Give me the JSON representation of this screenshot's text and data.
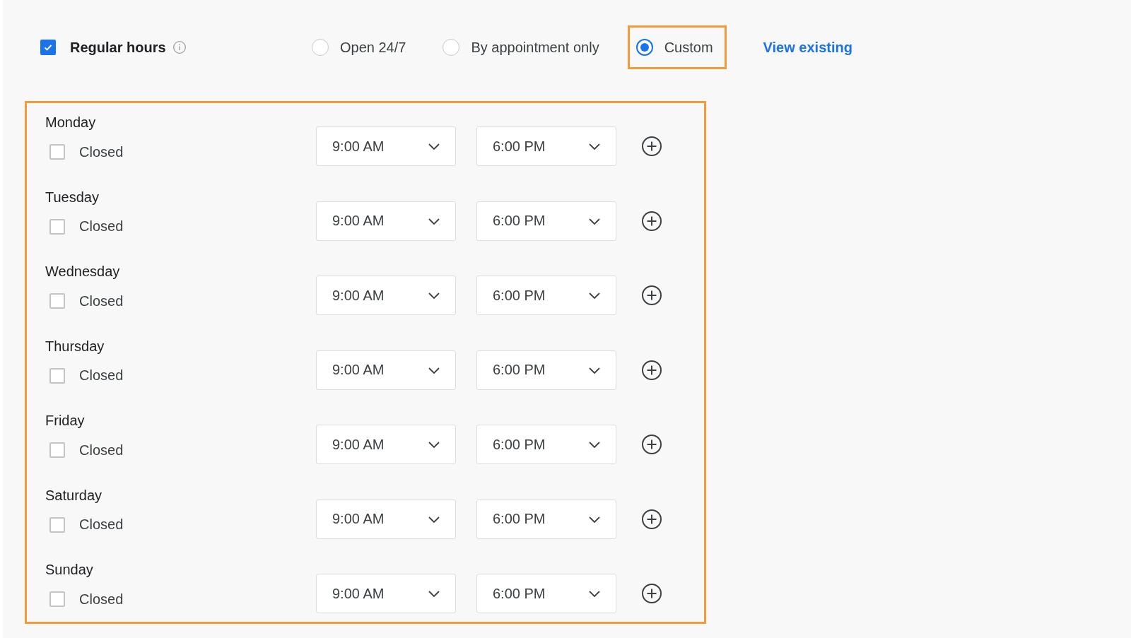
{
  "regular_hours": {
    "label": "Regular hours",
    "checked": true
  },
  "options": [
    {
      "label": "Open 24/7",
      "selected": false,
      "highlighted": false
    },
    {
      "label": "By appointment only",
      "selected": false,
      "highlighted": false
    },
    {
      "label": "Custom",
      "selected": true,
      "highlighted": true
    }
  ],
  "view_link": "View existing",
  "hours_panel": {
    "highlighted": true,
    "days": [
      {
        "day": "Monday",
        "closed_label": "Closed",
        "closed": false,
        "open": "9:00 AM",
        "close": "6:00 PM"
      },
      {
        "day": "Tuesday",
        "closed_label": "Closed",
        "closed": false,
        "open": "9:00 AM",
        "close": "6:00 PM"
      },
      {
        "day": "Wednesday",
        "closed_label": "Closed",
        "closed": false,
        "open": "9:00 AM",
        "close": "6:00 PM"
      },
      {
        "day": "Thursday",
        "closed_label": "Closed",
        "closed": false,
        "open": "9:00 AM",
        "close": "6:00 PM"
      },
      {
        "day": "Friday",
        "closed_label": "Closed",
        "closed": false,
        "open": "9:00 AM",
        "close": "6:00 PM"
      },
      {
        "day": "Saturday",
        "closed_label": "Closed",
        "closed": false,
        "open": "9:00 AM",
        "close": "6:00 PM"
      },
      {
        "day": "Sunday",
        "closed_label": "Closed",
        "closed": false,
        "open": "9:00 AM",
        "close": "6:00 PM"
      }
    ]
  }
}
